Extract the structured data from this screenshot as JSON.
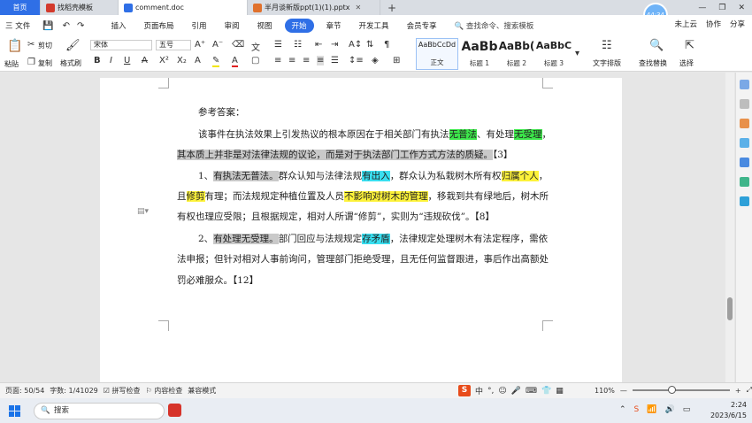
{
  "tabs": [
    {
      "label": "首页",
      "kind": "home"
    },
    {
      "label": "找稻壳模板",
      "icon_color": "#d33a2c"
    },
    {
      "label": "comment.doc",
      "icon_color": "#2f6fe6",
      "active": true
    },
    {
      "label": "半月谈新版ppt(1)(1).pptx",
      "icon_color": "#e0712c"
    }
  ],
  "timer_badge": "44:34",
  "window_controls": [
    "—",
    "❐",
    "✕"
  ],
  "menu": {
    "file": "三 文件",
    "items": [
      "插入",
      "页面布局",
      "引用",
      "审阅",
      "视图",
      "开始",
      "章节",
      "开发工具",
      "会员专享"
    ],
    "active": "开始",
    "search": "查找命令、搜索模板",
    "right": [
      "未上云",
      "协作",
      "分享"
    ]
  },
  "ribbon": {
    "paste": "粘贴",
    "cut": "剪切",
    "copy": "复制",
    "format_painter": "格式刷",
    "font_name": "宋体",
    "font_size": "五号",
    "styles": [
      {
        "sample": "AaBbCcDd",
        "name": "正文"
      },
      {
        "sample": "AaBb",
        "name": "标题 1"
      },
      {
        "sample": "AaBb(",
        "name": "标题 2"
      },
      {
        "sample": "AaBbC",
        "name": "标题 3"
      }
    ],
    "text_layout": "文字排版",
    "find_replace": "查找替换",
    "select": "选择"
  },
  "document": {
    "lines": [
      [
        {
          "t": "参考答案："
        }
      ],
      [
        {
          "t": "该事件在执法效果上引发热议的根本原因在于相关部门有执法"
        },
        {
          "t": "无普法",
          "hl": "g"
        },
        {
          "t": "、有处理"
        },
        {
          "t": "无受理",
          "hl": "g"
        },
        {
          "t": "，"
        }
      ],
      [
        {
          "t": "其本质上并非是对法律法规的议论，而是对于执法部门工作方式方法的质疑。",
          "hl": "gr"
        },
        {
          "t": "【3】"
        }
      ],
      [
        {
          "t": "1、"
        },
        {
          "t": "有执法无普法。",
          "hl": "gr"
        },
        {
          "t": "群众认知与法律法规"
        },
        {
          "t": "有出入",
          "hl": "c"
        },
        {
          "t": "，群众认为私栽树木所有权"
        },
        {
          "t": "归属个人",
          "hl": "y"
        },
        {
          "t": "，"
        }
      ],
      [
        {
          "t": "且"
        },
        {
          "t": "修剪",
          "hl": "y"
        },
        {
          "t": "有理；而法规规定种植位置及人员"
        },
        {
          "t": "不影响对树木的管理",
          "hl": "y"
        },
        {
          "t": "，移栽到共有绿地后，树木所"
        }
      ],
      [
        {
          "t": "有权也理应受限；且根据规定，相对人所谓“修剪”，实则为“违规砍伐”。【8】"
        }
      ],
      [
        {
          "t": "2、"
        },
        {
          "t": "有处理无受理。",
          "hl": "gr"
        },
        {
          "t": "部门回应与法规规定"
        },
        {
          "t": "存矛盾",
          "hl": "c"
        },
        {
          "t": "，法律规定处理树木有法定程序，需依"
        }
      ],
      [
        {
          "t": "法申报；但针对相对人事前询问，管理部门拒绝受理，且无任何监督跟进，事后作出高额处"
        }
      ],
      [
        {
          "t": "罚必难服众。【12】"
        }
      ]
    ]
  },
  "status": {
    "page": "页面: 50/54",
    "words": "字数: 1/41029",
    "spell": "拼写检查",
    "content_check": "内容检查",
    "compat": "兼容模式",
    "zoom": "110%",
    "zoom_fraction": 0.4
  },
  "ime": {
    "label": "中"
  },
  "taskbar": {
    "search": "搜索",
    "time": "2:24",
    "date": "2023/6/15"
  }
}
